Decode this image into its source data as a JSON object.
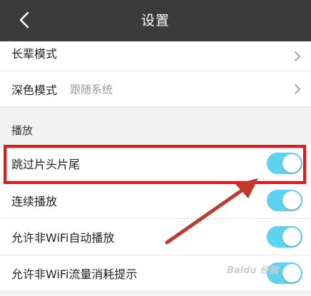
{
  "header": {
    "title": "设置",
    "back_icon": "chevron-left-icon"
  },
  "rows_top": [
    {
      "label": "长辈模式",
      "value": ""
    },
    {
      "label": "深色模式",
      "value": "跟随系统"
    }
  ],
  "section": {
    "title": "播放"
  },
  "toggle_rows": [
    {
      "label": "跳过片头片尾",
      "on": true
    },
    {
      "label": "连续播放",
      "on": true
    },
    {
      "label": "允许非WiFi自动播放",
      "on": true
    },
    {
      "label": "允许非WiFi流量消耗提示",
      "on": true
    }
  ],
  "annotation": {
    "highlight_color": "#e8141b",
    "arrow_color": "#c0392b"
  },
  "watermark": {
    "text": "Baidu 经验"
  },
  "colors": {
    "header_bg": "#3b3b3b",
    "toggle_on": "#5ed3ef",
    "page_bg": "#f2f2f2"
  }
}
